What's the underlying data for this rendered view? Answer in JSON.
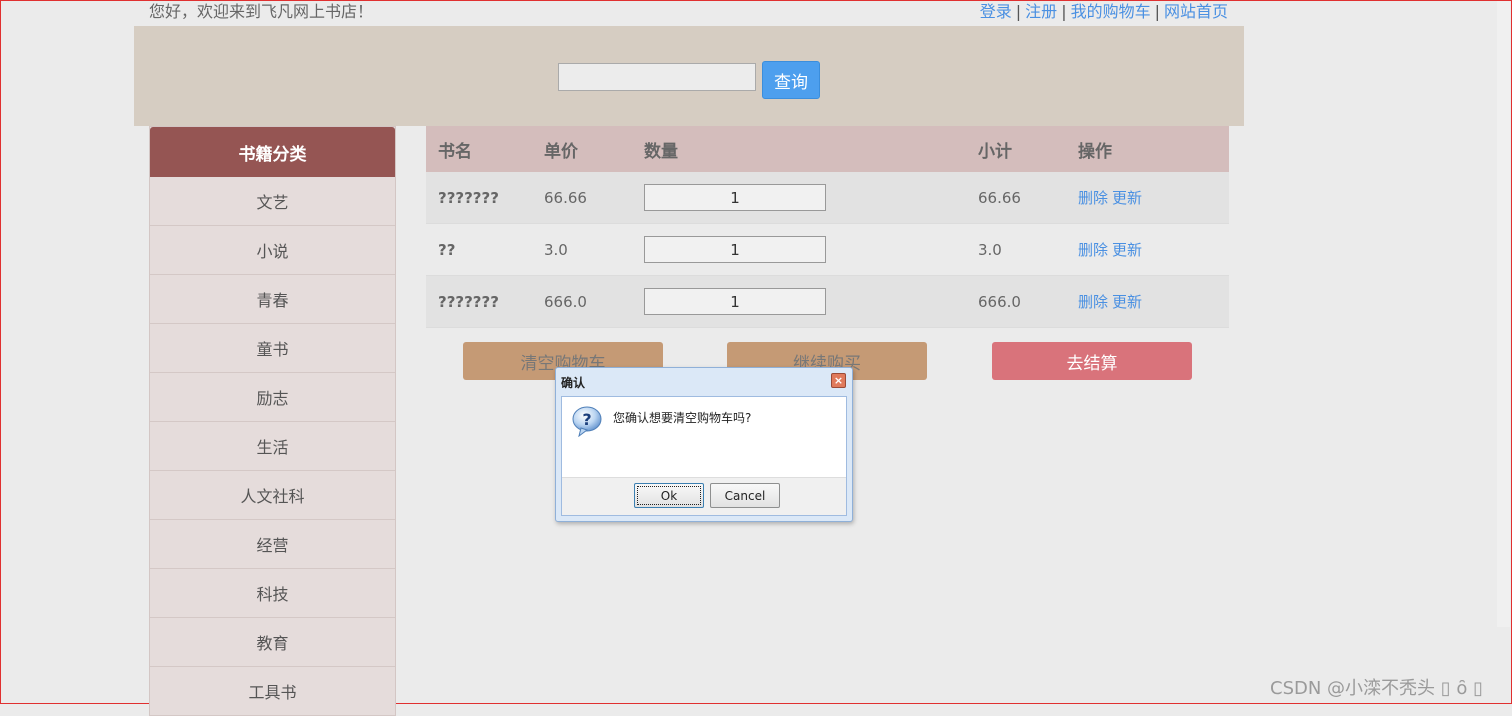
{
  "topbar": {
    "welcome": "您好，欢迎来到飞凡网上书店！",
    "links": [
      "登录",
      "注册",
      "我的购物车",
      "网站首页"
    ],
    "separator": "|"
  },
  "search": {
    "button_label": "查询",
    "value": ""
  },
  "sidebar": {
    "title": "书籍分类",
    "items": [
      "文艺",
      "小说",
      "青春",
      "童书",
      "励志",
      "生活",
      "人文社科",
      "经营",
      "科技",
      "教育",
      "工具书"
    ]
  },
  "cart": {
    "headers": [
      "书名",
      "单价",
      "数量",
      "小计",
      "操作"
    ],
    "rows": [
      {
        "name": "???????",
        "price": "66.66",
        "qty": "1",
        "subtotal": "66.66",
        "delete": "删除",
        "update": "更新"
      },
      {
        "name": "??",
        "price": "3.0",
        "qty": "1",
        "subtotal": "3.0",
        "delete": "删除",
        "update": "更新"
      },
      {
        "name": "???????",
        "price": "666.0",
        "qty": "1",
        "subtotal": "666.0",
        "delete": "删除",
        "update": "更新"
      }
    ]
  },
  "actions": {
    "clear": "清空购物车",
    "continue": "继续购买",
    "checkout": "去结算"
  },
  "dialog": {
    "title": "确认",
    "message": "您确认想要清空购物车吗?",
    "ok": "Ok",
    "cancel": "Cancel",
    "close": "×"
  },
  "watermark": "CSDN @小滦不秃头 ▯ ȏ ▯"
}
